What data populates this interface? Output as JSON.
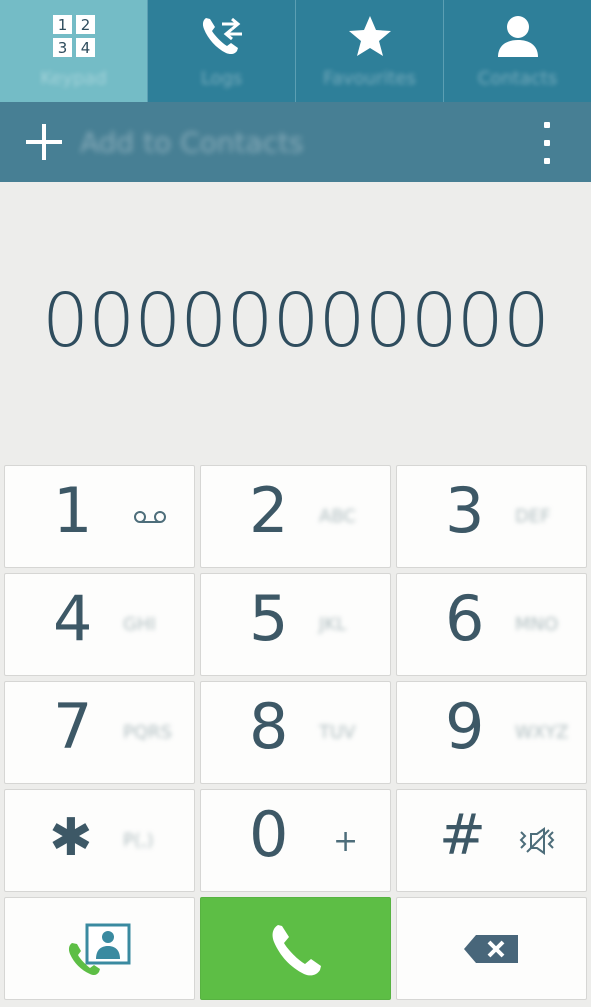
{
  "tabs": [
    {
      "label": "Keypad",
      "icon": "keypad-icon",
      "active": true
    },
    {
      "label": "Logs",
      "icon": "call-logs-icon",
      "active": false
    },
    {
      "label": "Favourites",
      "icon": "star-icon",
      "active": false
    },
    {
      "label": "Contacts",
      "icon": "contact-icon",
      "active": false
    }
  ],
  "keypad_icon_digits": [
    "1",
    "2",
    "3",
    "4"
  ],
  "action_bar": {
    "add_label": "Add to Contacts"
  },
  "display": {
    "number": "00000000000"
  },
  "keys": [
    {
      "digit": "1",
      "sub": ""
    },
    {
      "digit": "2",
      "sub": "ABC"
    },
    {
      "digit": "3",
      "sub": "DEF"
    },
    {
      "digit": "4",
      "sub": "GHI"
    },
    {
      "digit": "5",
      "sub": "JKL"
    },
    {
      "digit": "6",
      "sub": "MNO"
    },
    {
      "digit": "7",
      "sub": "PQRS"
    },
    {
      "digit": "8",
      "sub": "TUV"
    },
    {
      "digit": "9",
      "sub": "WXYZ"
    },
    {
      "digit": "✱",
      "sub": "P(,)"
    },
    {
      "digit": "0",
      "sub": "+"
    },
    {
      "digit": "#",
      "sub": ""
    }
  ],
  "colors": {
    "tab_active": "#74bcc6",
    "tab_inactive": "#2e7f99",
    "action_bar": "#477f94",
    "call_button": "#5dbe45",
    "digit_text": "#3d5866"
  }
}
